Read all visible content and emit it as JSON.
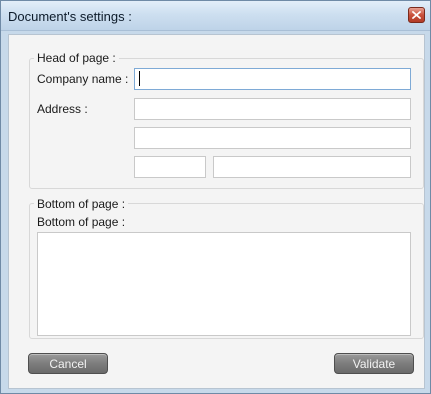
{
  "window": {
    "title": "Document's settings :",
    "close_icon": "close-icon"
  },
  "head_of_page": {
    "legend": "Head of page :",
    "company_name_label": "Company name :",
    "company_name_value": "",
    "address_label": "Address :",
    "address_line1": "",
    "address_line2": "",
    "postal_code": "",
    "city": ""
  },
  "bottom_of_page": {
    "legend": "Bottom of page :",
    "label": "Bottom of page :",
    "text": ""
  },
  "buttons": {
    "cancel": "Cancel",
    "validate": "Validate"
  },
  "colors": {
    "title_bar": "#cddff0",
    "close_button": "#c9503b",
    "button_gray": "#7d7d7d",
    "focus_border": "#7eaad6"
  }
}
